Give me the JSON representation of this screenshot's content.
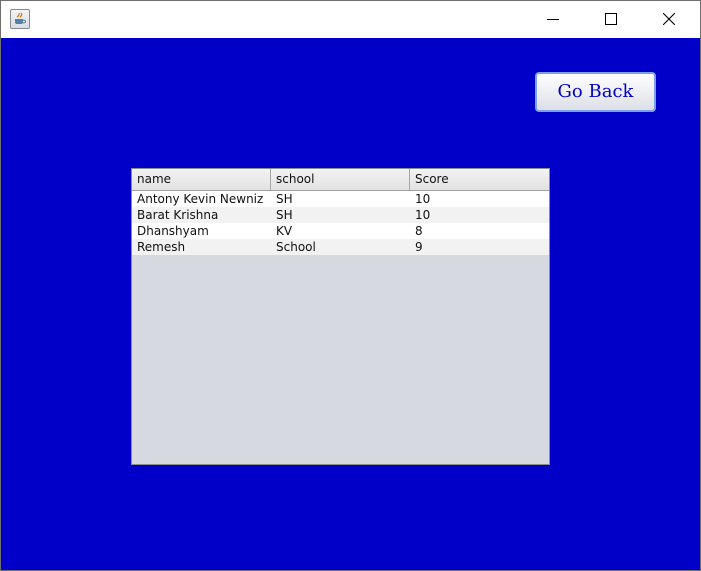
{
  "window": {
    "title": ""
  },
  "buttons": {
    "go_back": "Go Back"
  },
  "table": {
    "columns": [
      "name",
      "school",
      "Score"
    ],
    "rows": [
      [
        "Antony Kevin Newniz",
        "SH",
        "10"
      ],
      [
        "Barat Krishna",
        "SH",
        "10"
      ],
      [
        "Dhanshyam",
        "KV",
        "8"
      ],
      [
        "Remesh",
        "School",
        "9"
      ]
    ]
  },
  "colors": {
    "background": "#0000c8",
    "button_text": "#0000c0",
    "table_empty": "#d6d9df"
  },
  "icons": {
    "app": "java-icon",
    "minimize": "minimize-icon",
    "maximize": "maximize-icon",
    "close": "close-icon"
  }
}
